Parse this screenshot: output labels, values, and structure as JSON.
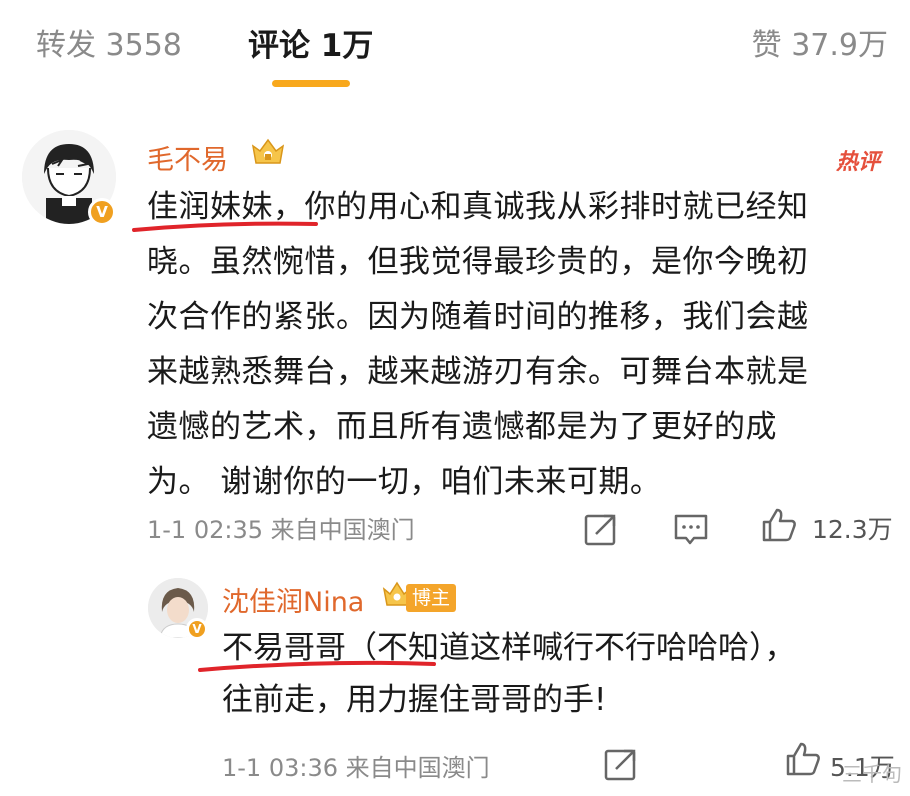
{
  "tabs": {
    "repost": "转发 3558",
    "comment": "评论 1万",
    "like": "赞 37.9万"
  },
  "main_comment": {
    "username": "毛不易",
    "verified_badge": "V",
    "hot_tag": "热评",
    "lines": [
      "佳润妹妹，你的用心和真诚我从彩排时就已经知",
      "晓。虽然惋惜，但我觉得最珍贵的，是你今晚初",
      "次合作的紧张。因为随着时间的推移，我们会越",
      "来越熟悉舞台，越来越游刃有余。可舞台本就是",
      "遗憾的艺术，而且所有遗憾都是为了更好的成",
      "为。 谢谢你的一切，咱们未来可期。"
    ],
    "meta": "1-1 02:35  来自中国澳门",
    "like_count": "12.3万"
  },
  "reply_comment": {
    "username": "沈佳润Nina",
    "badge": "博主",
    "lines": [
      "不易哥哥（不知道这样喊行不行哈哈哈），",
      "往前走，用力握住哥哥的手!"
    ],
    "meta": "1-1 03:36  来自中国澳门",
    "like_count": "5.1万"
  },
  "watermark": "三千句",
  "colors": {
    "accent": "#f8a81c",
    "username": "#e0682c",
    "hot": "#e5503c",
    "underline": "#e0242a",
    "muted": "#8a8a8a"
  },
  "icons": [
    "share-icon",
    "reply-icon",
    "like-icon",
    "crown-icon",
    "verified-icon"
  ]
}
